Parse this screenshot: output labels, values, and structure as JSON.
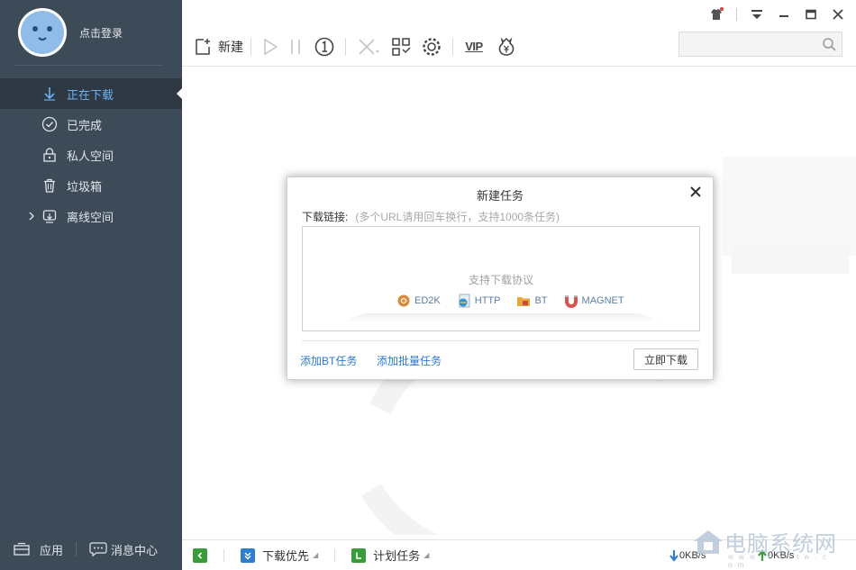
{
  "sidebar": {
    "login_text": "点击登录",
    "items": [
      {
        "label": "正在下载",
        "icon": "download-arrow-icon",
        "active": true
      },
      {
        "label": "已完成",
        "icon": "check-circle-icon",
        "active": false
      },
      {
        "label": "私人空间",
        "icon": "lock-icon",
        "active": false
      },
      {
        "label": "垃圾箱",
        "icon": "trash-icon",
        "active": false
      },
      {
        "label": "离线空间",
        "icon": "cloud-download-icon",
        "active": false
      }
    ],
    "bottom": {
      "apps_label": "应用",
      "messages_label": "消息中心"
    }
  },
  "toolbar": {
    "new_label": "新建",
    "vip_label": "VIP",
    "search_placeholder": ""
  },
  "dialog": {
    "title": "新建任务",
    "url_label": "下载链接:",
    "url_hint": "(多个URL请用回车换行，支持1000条任务)",
    "protocols_title": "支持下载协议",
    "protocols": [
      {
        "label": "ED2K",
        "icon": "ed2k-icon"
      },
      {
        "label": "HTTP",
        "icon": "http-icon"
      },
      {
        "label": "BT",
        "icon": "bt-icon"
      },
      {
        "label": "MAGNET",
        "icon": "magnet-icon"
      }
    ],
    "link_add_bt": "添加BT任务",
    "link_add_batch": "添加批量任务",
    "download_button": "立即下载"
  },
  "statusbar": {
    "priority_label": "下载优先",
    "schedule_label": "计划任务",
    "down_speed": "0KB/s",
    "up_speed": "0KB/s"
  },
  "watermark": {
    "site_name": "电脑系统网",
    "site_url": "w w w . d n x t w . c o m"
  },
  "colors": {
    "sidebar_bg": "#3d4a57",
    "accent_blue": "#2b7ad0",
    "active_text": "#6db2f2"
  }
}
